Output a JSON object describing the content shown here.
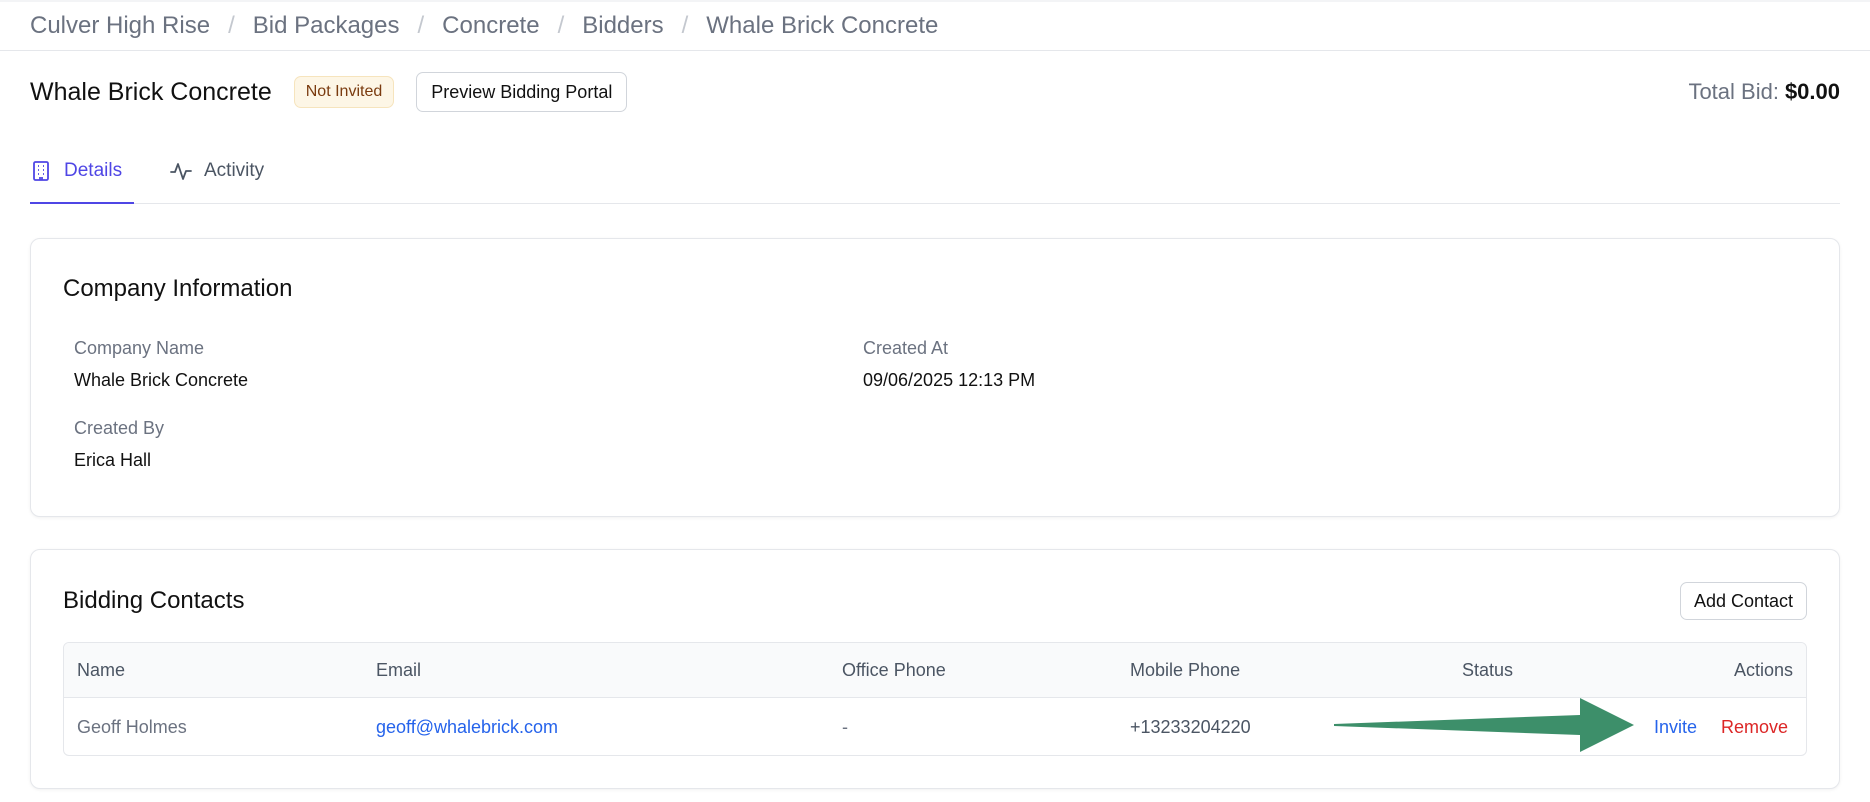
{
  "breadcrumb": {
    "items": [
      "Culver High Rise",
      "Bid Packages",
      "Concrete",
      "Bidders",
      "Whale Brick Concrete"
    ],
    "separator": "/"
  },
  "header": {
    "title": "Whale Brick Concrete",
    "status_badge": "Not Invited",
    "preview_button": "Preview Bidding Portal",
    "total_bid_label": "Total Bid:",
    "total_bid_value": "$0.00"
  },
  "tabs": [
    {
      "label": "Details",
      "icon": "building-icon",
      "active": true
    },
    {
      "label": "Activity",
      "icon": "activity-icon",
      "active": false
    }
  ],
  "company_info": {
    "title": "Company Information",
    "fields": {
      "company_name": {
        "label": "Company Name",
        "value": "Whale Brick Concrete"
      },
      "created_at": {
        "label": "Created At",
        "value": "09/06/2025 12:13 PM"
      },
      "created_by": {
        "label": "Created By",
        "value": "Erica Hall"
      }
    }
  },
  "contacts": {
    "title": "Bidding Contacts",
    "add_button": "Add Contact",
    "columns": [
      "Name",
      "Email",
      "Office Phone",
      "Mobile Phone",
      "Status",
      "Actions"
    ],
    "rows": [
      {
        "name": "Geoff Holmes",
        "email": "geoff@whalebrick.com",
        "office_phone": "-",
        "mobile_phone": "+13233204220",
        "status": "",
        "actions": {
          "invite": "Invite",
          "remove": "Remove"
        }
      }
    ]
  },
  "colors": {
    "accent": "#4f46e5",
    "link": "#2563eb",
    "danger": "#dc2626",
    "badge_bg": "#fdf6e6",
    "badge_text": "#7a3b0f",
    "annotation_arrow": "#3d8f6a"
  }
}
